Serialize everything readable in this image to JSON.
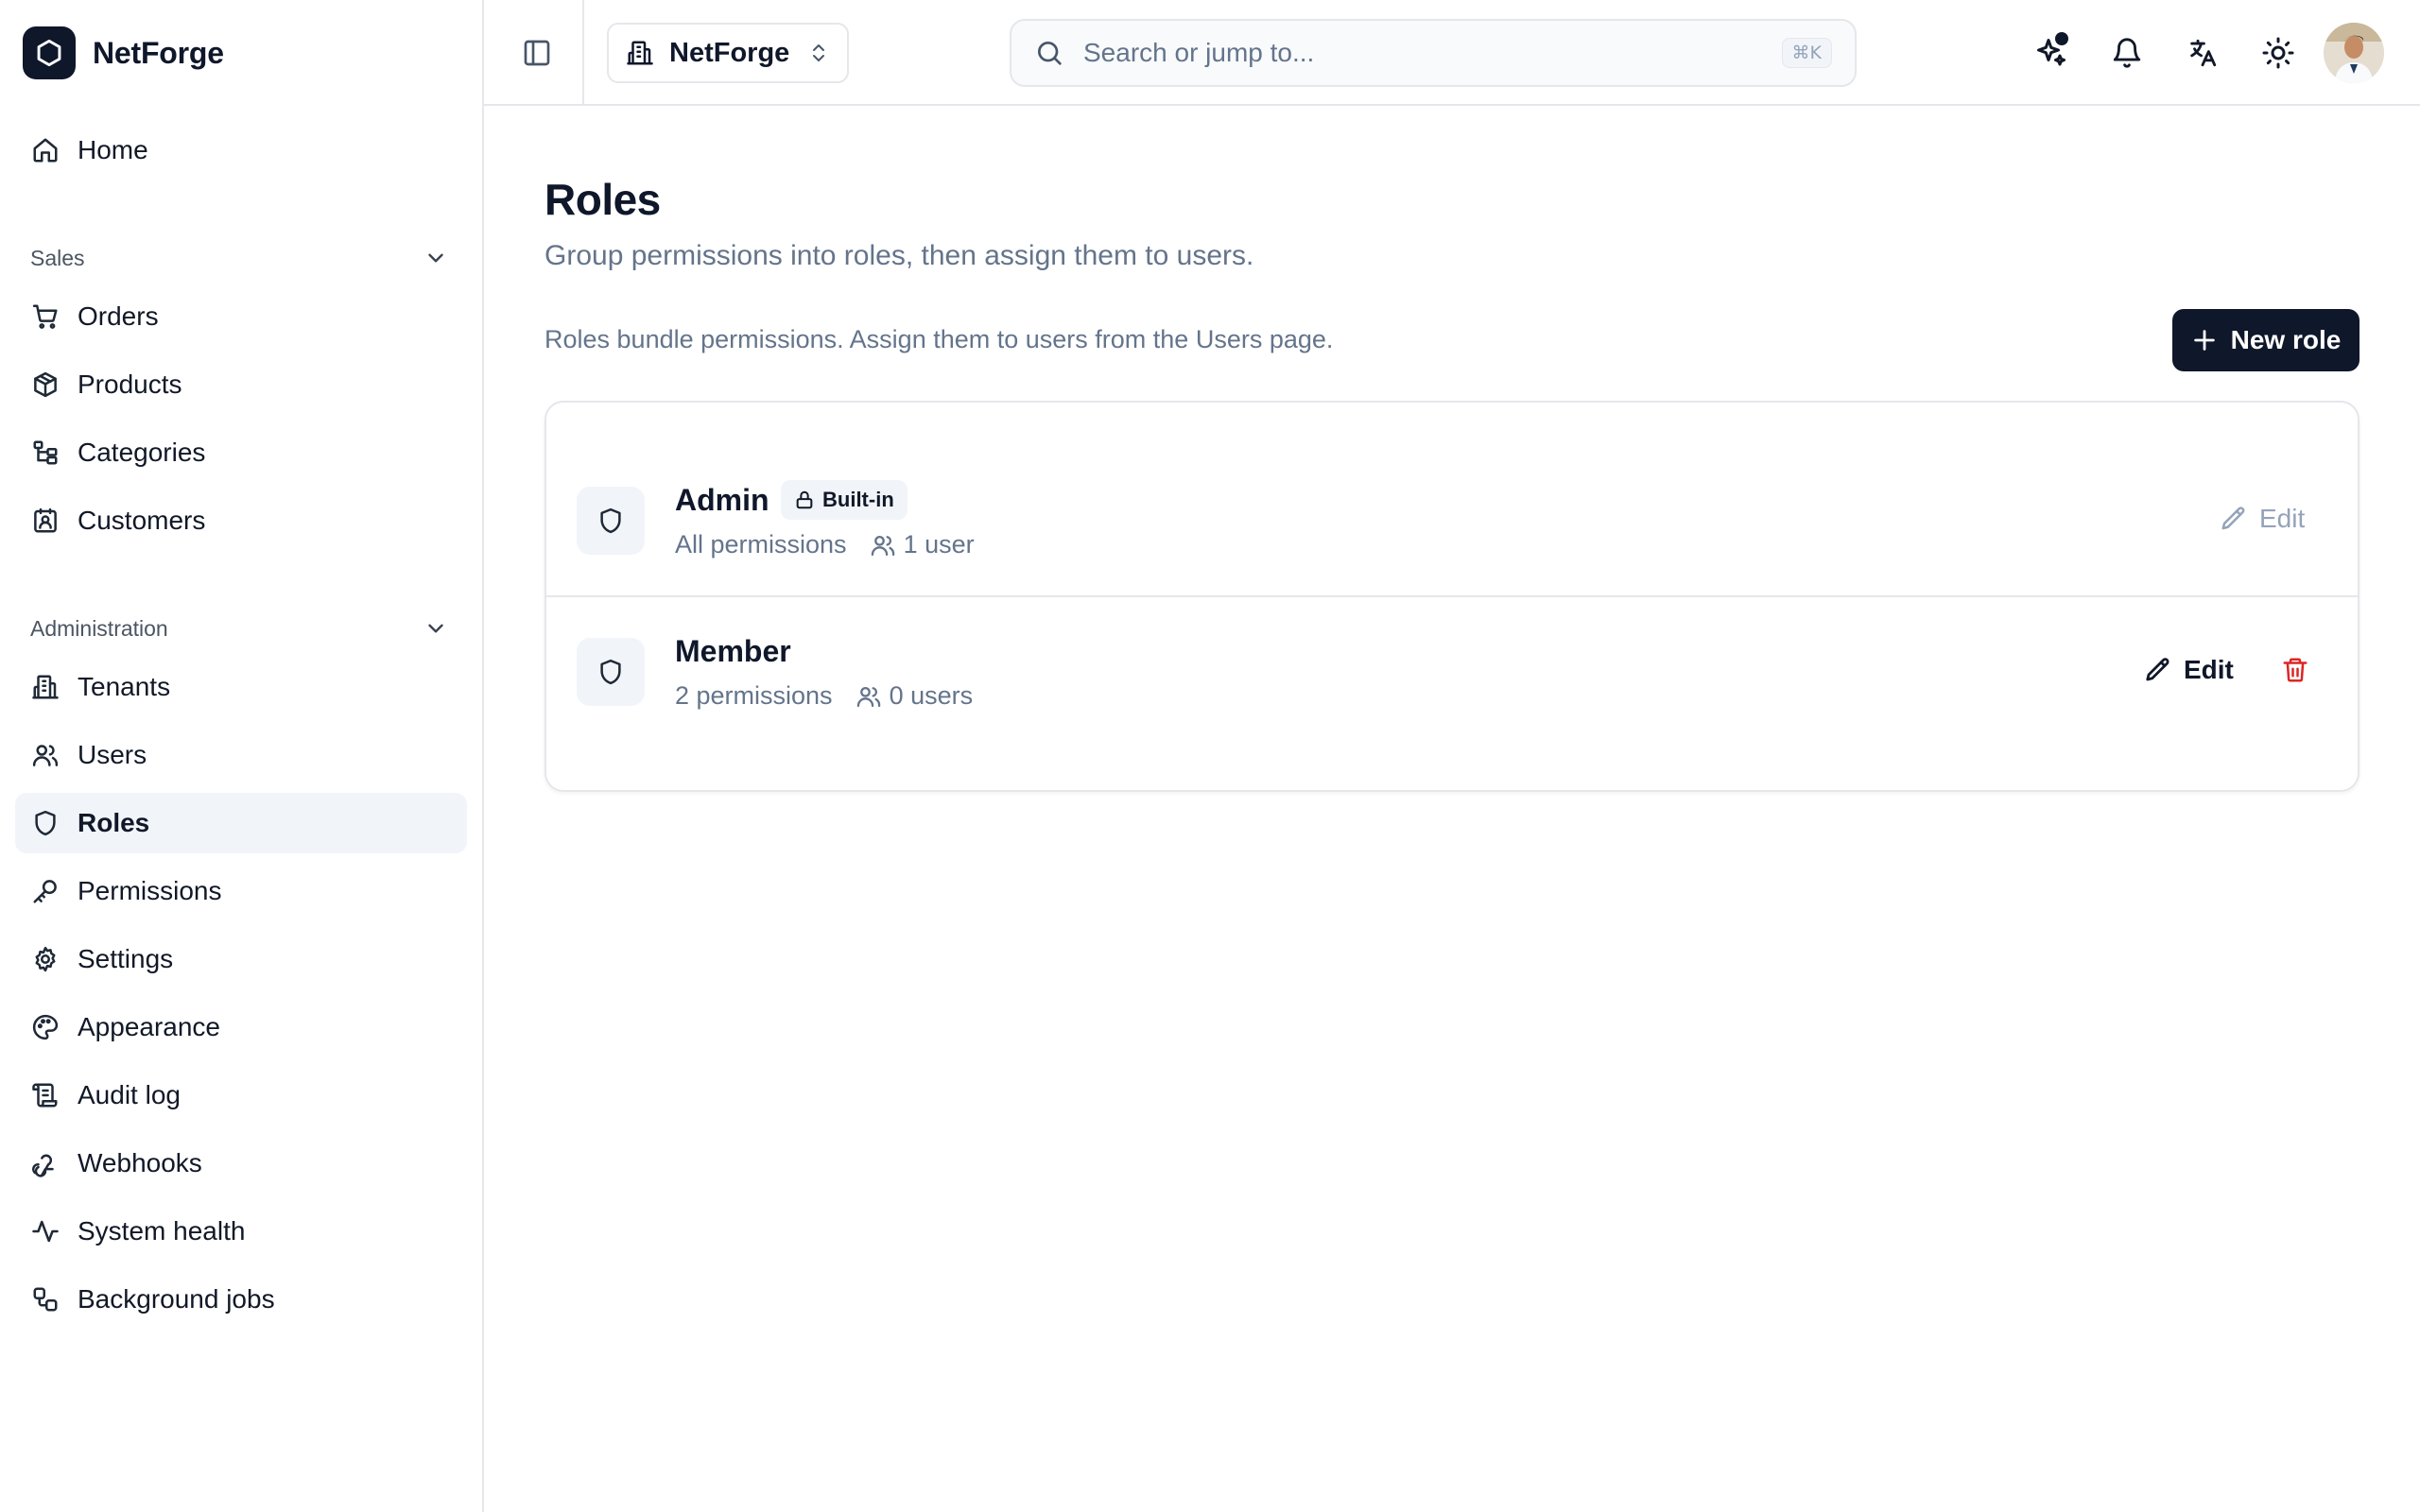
{
  "app": {
    "name": "NetForge"
  },
  "sidebar": {
    "home": "Home",
    "sections": [
      {
        "label": "Sales",
        "items": [
          "Orders",
          "Products",
          "Categories",
          "Customers"
        ]
      },
      {
        "label": "Administration",
        "items": [
          "Tenants",
          "Users",
          "Roles",
          "Permissions",
          "Settings",
          "Appearance",
          "Audit log",
          "Webhooks",
          "System health",
          "Background jobs"
        ]
      }
    ],
    "active": "Roles"
  },
  "topbar": {
    "tenant": "NetForge",
    "search_placeholder": "Search or jump to...",
    "search_shortcut": "⌘K"
  },
  "page": {
    "title": "Roles",
    "subtitle": "Group permissions into roles, then assign them to users.",
    "help": "Roles bundle permissions. Assign them to users from the Users page.",
    "new_button": "New role"
  },
  "roles": [
    {
      "name": "Admin",
      "badge": "Built-in",
      "permissions": "All permissions",
      "users": "1 user",
      "edit_label": "Edit",
      "editable": false,
      "deletable": false
    },
    {
      "name": "Member",
      "badge": "",
      "permissions": "2 permissions",
      "users": "0 users",
      "edit_label": "Edit",
      "editable": true,
      "deletable": true
    }
  ],
  "colors": {
    "primary": "#0f172a",
    "muted": "#64748b",
    "danger": "#dc2626",
    "border": "#e5e7eb",
    "active_bg": "#f1f5f9"
  }
}
